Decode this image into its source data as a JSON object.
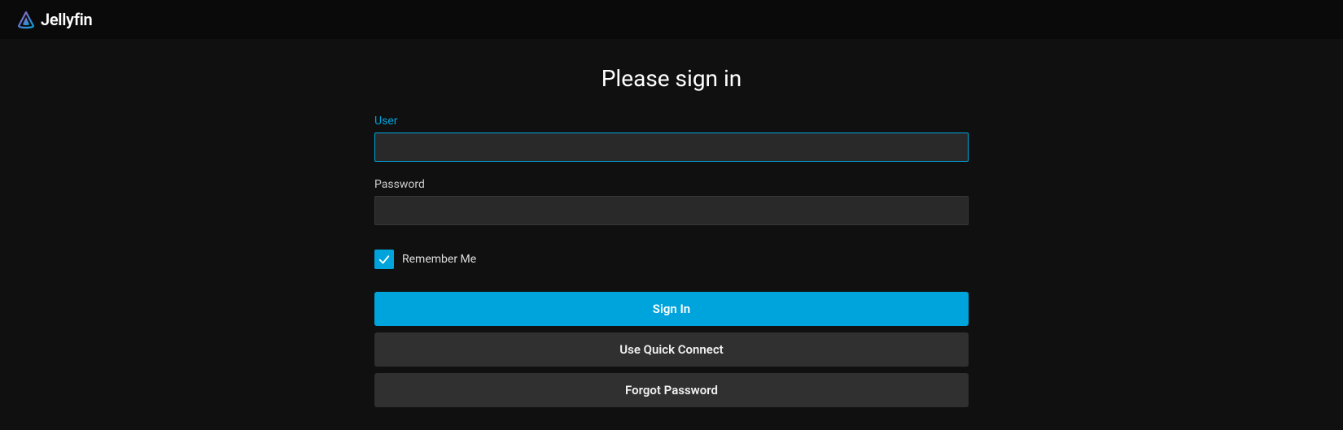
{
  "header": {
    "brand_name": "Jellyfin"
  },
  "login": {
    "title": "Please sign in",
    "user_label": "User",
    "user_value": "",
    "password_label": "Password",
    "password_value": "",
    "remember_label": "Remember Me",
    "remember_checked": true,
    "signin_button": "Sign In",
    "quick_connect_button": "Use Quick Connect",
    "forgot_button": "Forgot Password"
  },
  "colors": {
    "accent": "#00a4dc",
    "background": "#101010",
    "input_bg": "#292929",
    "secondary_btn": "#303030"
  }
}
